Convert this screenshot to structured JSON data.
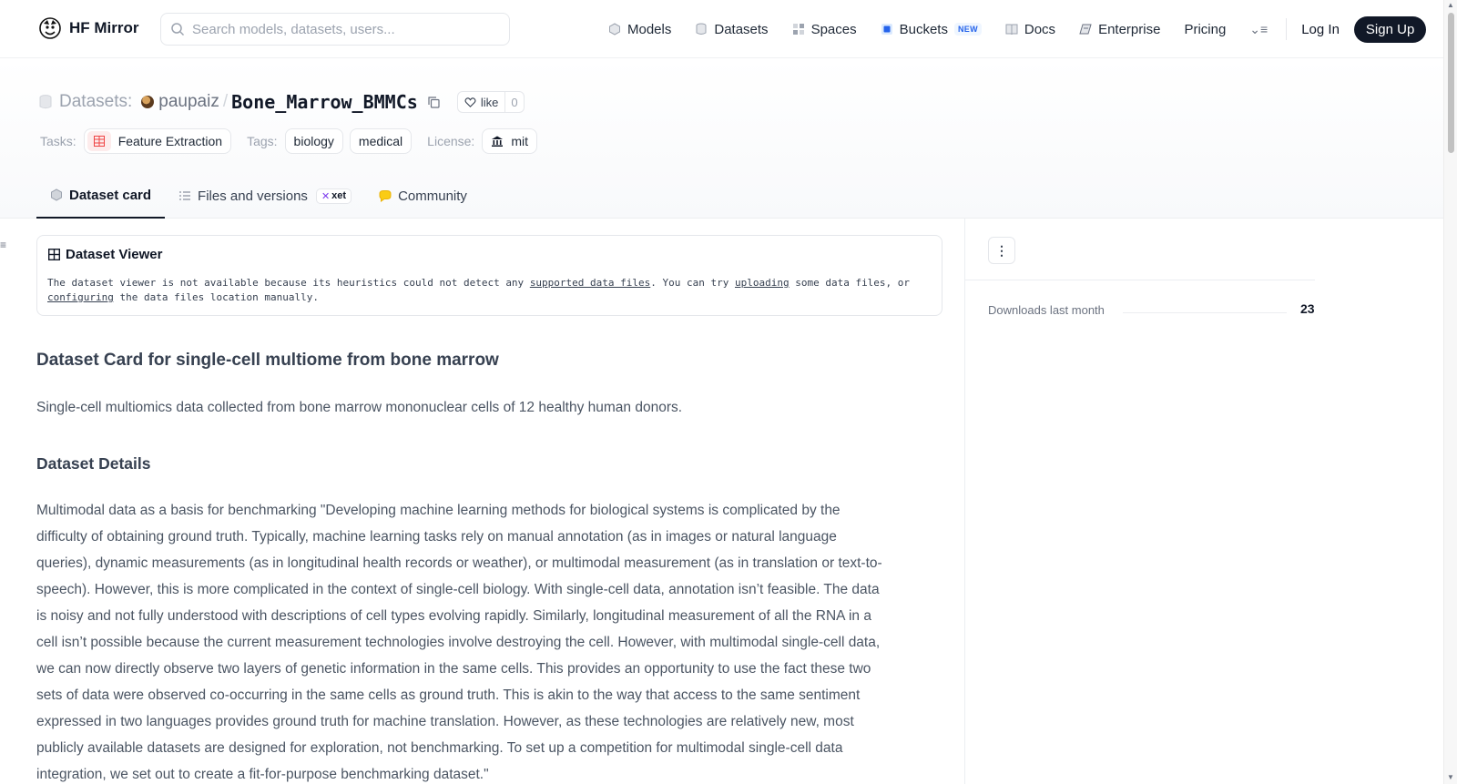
{
  "nav": {
    "brand": "HF Mirror",
    "search_placeholder": "Search models, datasets, users...",
    "items": [
      {
        "label": "Models",
        "icon": "cube-icon"
      },
      {
        "label": "Datasets",
        "icon": "database-icon"
      },
      {
        "label": "Spaces",
        "icon": "grid-icon"
      },
      {
        "label": "Buckets",
        "icon": "bucket-icon",
        "badge": "NEW"
      },
      {
        "label": "Docs",
        "icon": "book-icon"
      },
      {
        "label": "Enterprise",
        "icon": "enterprise-icon"
      },
      {
        "label": "Pricing"
      }
    ],
    "login": "Log In",
    "signup": "Sign Up"
  },
  "header": {
    "prefix": "Datasets:",
    "owner": "paupaiz",
    "separator": "/",
    "repo": "Bone_Marrow_BMMCs",
    "like_label": "like",
    "like_count": "0",
    "tasks_label": "Tasks:",
    "task": "Feature Extraction",
    "tags_label": "Tags:",
    "tags": [
      "biology",
      "medical"
    ],
    "license_label": "License:",
    "license": "mit"
  },
  "tabs": [
    {
      "label": "Dataset card",
      "active": true
    },
    {
      "label": "Files and versions",
      "badge": "xet"
    },
    {
      "label": "Community"
    }
  ],
  "viewer": {
    "title": "Dataset Viewer",
    "msg_1": "The dataset viewer is not available because its heuristics could not detect any ",
    "link_1": "supported data files",
    "msg_2": ". You can try ",
    "link_2": "uploading",
    "msg_3": " some data files, or ",
    "link_3": "configuring",
    "msg_4": " the data files location manually."
  },
  "card": {
    "title": "Dataset Card for single-cell multiome from bone marrow",
    "summary": "Single-cell multiomics data collected from bone marrow mononuclear cells of 12 healthy human donors.",
    "details_heading": "Dataset Details",
    "details_text": "Multimodal data as a basis for benchmarking \"Developing machine learning methods for biological systems is complicated by the difficulty of obtaining ground truth. Typically, machine learning tasks rely on manual annotation (as in images or natural language queries), dynamic measurements (as in longitudinal health records or weather), or multimodal measurement (as in translation or text-to-speech). However, this is more complicated in the context of single-cell biology. With single-cell data, annotation isn’t feasible. The data is noisy and not fully understood with descriptions of cell types evolving rapidly. Similarly, longitudinal measurement of all the RNA in a cell isn’t possible because the current measurement technologies involve destroying the cell. However, with multimodal single-cell data, we can now directly observe two layers of genetic information in the same cells. This provides an opportunity to use the fact these two sets of data were observed co-occurring in the same cells as ground truth. This is akin to the way that access to the same sentiment expressed in two languages provides ground truth for machine translation. However, as these technologies are relatively new, most publicly available datasets are designed for exploration, not benchmarking. To set up a competition for multimodal single-cell data integration, we set out to create a fit-for-purpose benchmarking dataset.\""
  },
  "sidebar": {
    "downloads_label": "Downloads last month",
    "downloads_value": "23"
  },
  "colors": {
    "dark": "#111827",
    "muted": "#9ca3af",
    "buckets_blue": "#2563eb",
    "task_red": "#ef4444",
    "community_yellow": "#facc15"
  }
}
